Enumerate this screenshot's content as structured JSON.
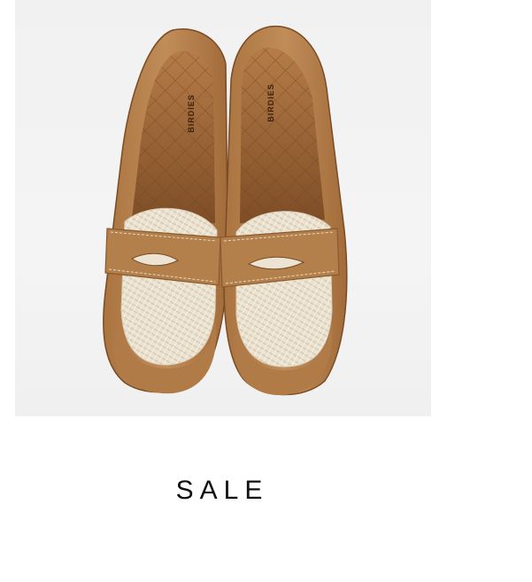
{
  "product": {
    "image_alt": "",
    "brand_imprint": "BIRDIES",
    "cta_label": "SALE"
  },
  "colors": {
    "leather": "#b98552",
    "leather_dark": "#8e5e33",
    "raffia": "#ece3d2",
    "insole_quilt": "#a0693b",
    "background": "#f2f2f2",
    "text": "#111111"
  }
}
